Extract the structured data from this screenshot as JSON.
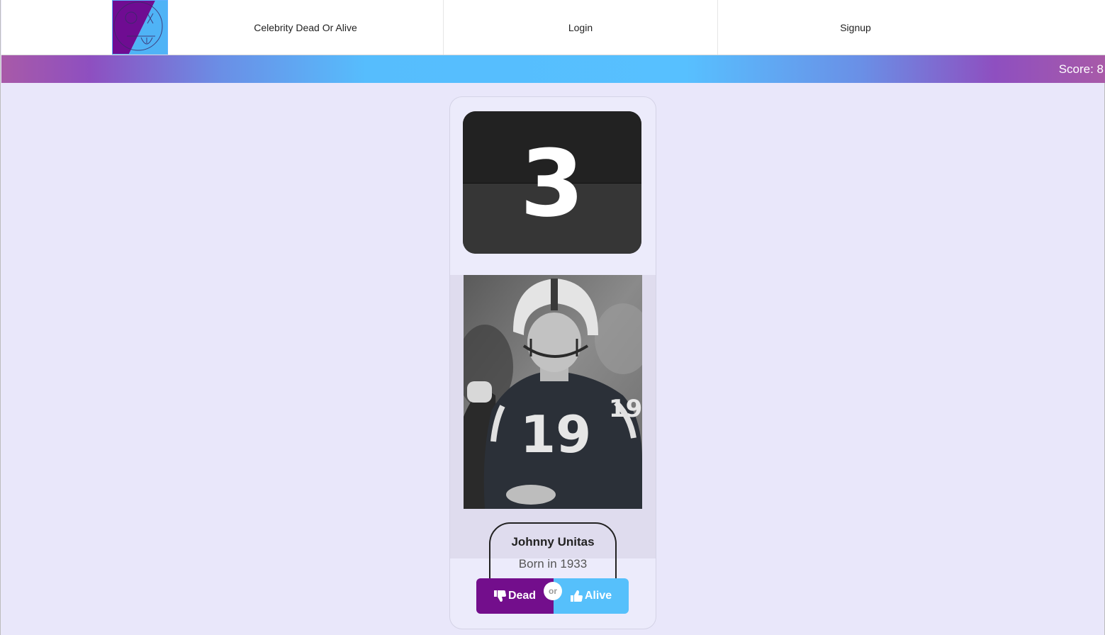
{
  "nav": {
    "logo_icon": "game-logo-icon",
    "title": "Celebrity Dead Or Alive",
    "login": "Login",
    "signup": "Signup"
  },
  "scorebar": {
    "score_text": "Score: 8"
  },
  "card": {
    "timer_value": "3",
    "celebrity": {
      "name": "Johnny Unitas",
      "born": "Born in 1933"
    },
    "buttons": {
      "dead_label": "Dead",
      "dead_icon": "thumbs-down-icon",
      "or_label": "or",
      "alive_label": "Alive",
      "alive_icon": "thumbs-up-icon"
    }
  },
  "colors": {
    "dead": "#730e8c",
    "alive": "#56c0fb",
    "background": "#e9e7fa"
  }
}
